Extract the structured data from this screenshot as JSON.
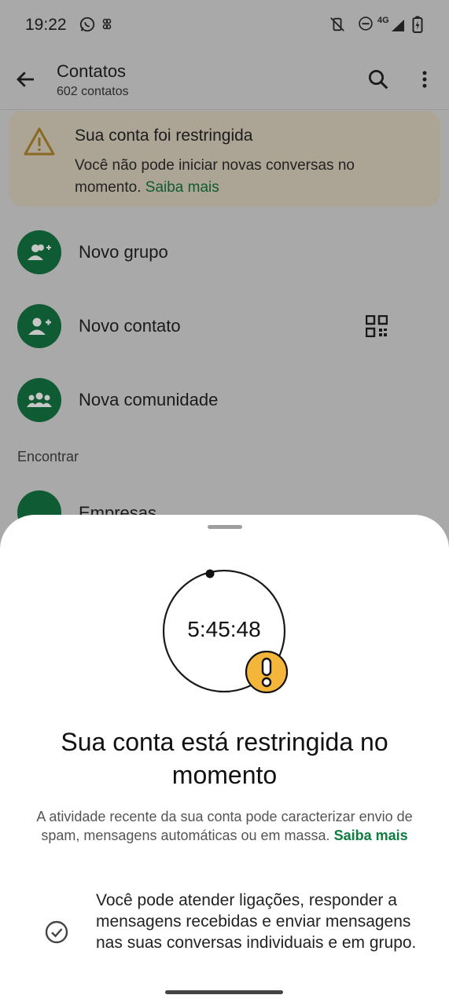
{
  "status_bar": {
    "time": "19:22",
    "left_icons": [
      "whatsapp-icon",
      "notification-icon"
    ],
    "right_icons": [
      "vibrate-off-icon",
      "do-not-disturb-icon",
      "signal-4g-icon",
      "battery-charging-icon"
    ],
    "network_label": "4G"
  },
  "app_bar": {
    "title": "Contatos",
    "subtitle": "602 contatos",
    "icons": [
      "back-arrow-icon",
      "search-icon",
      "more-vert-icon"
    ]
  },
  "banner": {
    "title": "Sua conta foi restringida",
    "text": "Você não pode iniciar novas conversas no momento.",
    "link": "Saiba mais",
    "bg_color": "#aca495",
    "icon": "warning-icon"
  },
  "list": {
    "items": [
      {
        "label": "Novo grupo",
        "icon": "group-add-icon"
      },
      {
        "label": "Novo contato",
        "icon": "person-add-icon",
        "trailing_icon": "qr-code-icon"
      },
      {
        "label": "Nova comunidade",
        "icon": "community-icon"
      }
    ],
    "section_header": "Encontrar",
    "partial_item": {
      "label": "Empresas",
      "icon": "business-icon"
    }
  },
  "sheet": {
    "timer": "5:45:48",
    "timer_badge_icon": "exclamation-badge-icon",
    "headline": "Sua conta está restringida no momento",
    "description": "A atividade recente da sua conta pode caracterizar envio de spam, mensagens automáticas ou em massa.",
    "description_link": "Saiba mais",
    "info_icon": "check-circle-icon",
    "info_text": "Você pode atender ligações, responder a mensagens recebidas e enviar mensagens nas suas conversas individuais e em grupo."
  },
  "colors": {
    "accent_green": "#0f7d3f",
    "warning_yellow": "#f3b63a",
    "dim_overlay": "#a9a9a9"
  }
}
